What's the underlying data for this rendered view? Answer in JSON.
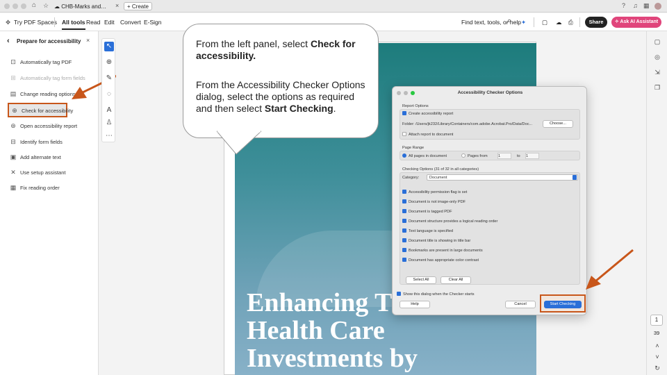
{
  "titlebar": {
    "doc_tab": "CHB-Marks and…",
    "create_tab": "+ Create"
  },
  "toolbar": {
    "try_spaces": "Try PDF Spaces",
    "menu": [
      "All tools",
      "Read",
      "Edit",
      "Convert",
      "E-Sign"
    ],
    "search": "Find text, tools, or help",
    "share": "Share",
    "ai": "Ask AI Assistant"
  },
  "panel": {
    "title": "Prepare for accessibility",
    "items": [
      "Automatically tag PDF",
      "Automatically tag form fields",
      "Change reading options",
      "Check for accessibility",
      "Open accessibility report",
      "Identify form fields",
      "Add alternate text",
      "Use setup assistant",
      "Fix reading order"
    ]
  },
  "callout": {
    "line1_pre": "From the left panel, select ",
    "line1_bold": "Check for accessibility.",
    "line2_pre": "From the Accessibility Checker Options dialog, select the options as required and then select ",
    "line2_bold": "Start Checking",
    "line2_post": "."
  },
  "cover": {
    "line1": "Enhancing T",
    "line2": "Health Care",
    "line3": "Investments by"
  },
  "dialog": {
    "title": "Accessibility Checker Options",
    "report_options": "Report Options",
    "create_report": "Create accessibility report",
    "folder": "Folder: /Users/jk232/Library/Containers/com.adobe.Acrobat.Pro/Data/Doc...",
    "choose": "Choose...",
    "attach": "Attach report to document",
    "page_range": "Page Range",
    "all_pages": "All pages in document",
    "pages_from": "Pages from",
    "from_val": "1",
    "to": "to",
    "to_val": "1",
    "checking_options": "Checking Options (31 of 32 in all categories)",
    "category_label": "Category:",
    "category_value": "Document",
    "checks": [
      "Accessibility permission flag is set",
      "Document is not image-only PDF",
      "Document is tagged PDF",
      "Document structure provides a logical reading order",
      "Text language is specified",
      "Document title is showing in title bar",
      "Bookmarks are present in large documents",
      "Document has appropriate color contrast"
    ],
    "select_all": "Select All",
    "clear_all": "Clear All",
    "show_dialog": "Show this dialog when the Checker starts",
    "help": "Help",
    "cancel": "Cancel",
    "start": "Start Checking"
  },
  "pager": {
    "current": "1",
    "total": "39"
  },
  "colors": {
    "highlight": "#c8561a",
    "accent": "#2a6fd8",
    "ai": "#e0457b"
  }
}
